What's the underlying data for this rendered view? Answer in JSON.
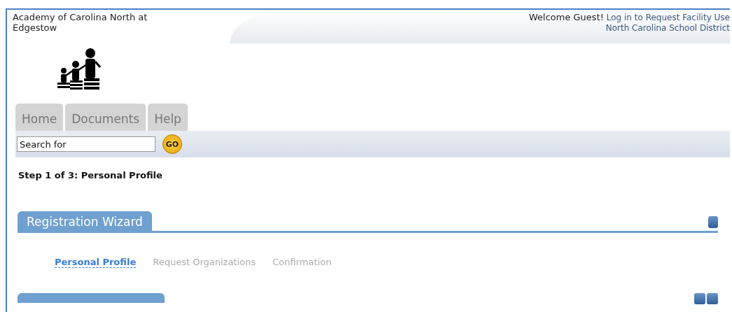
{
  "header": {
    "school_name": "Academy of Carolina North at Edgestow",
    "welcome": "Welcome Guest!",
    "login_link": "Log in to Request Facility Use",
    "district": "North Carolina School District"
  },
  "tabs": [
    {
      "label": "Home",
      "selected": false
    },
    {
      "label": "Documents",
      "selected": false
    },
    {
      "label": "Help",
      "selected": false
    }
  ],
  "search": {
    "placeholder": "Search for",
    "button": "GO"
  },
  "step_title": "Step 1 of 3: Personal Profile",
  "wizard": {
    "title": "Registration Wizard",
    "steps": [
      {
        "label": "Personal Profile",
        "selected": true
      },
      {
        "label": "Request Organizations",
        "selected": false
      },
      {
        "label": "Confirmation",
        "selected": false
      }
    ]
  }
}
